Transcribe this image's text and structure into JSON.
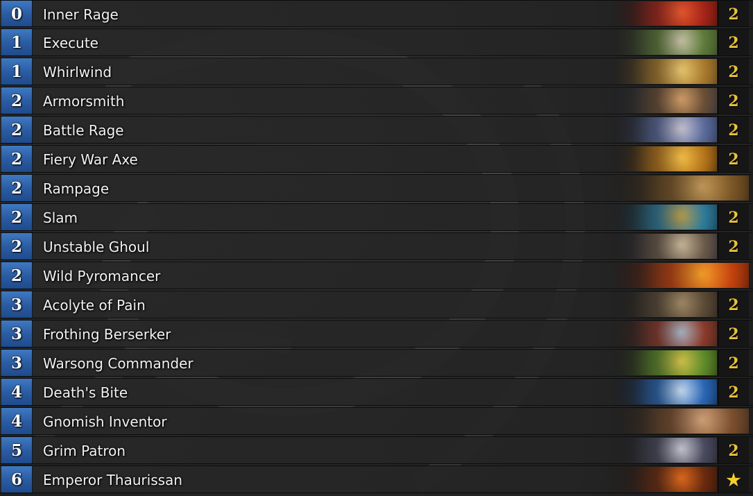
{
  "deck": {
    "cards": [
      {
        "cost": "0",
        "name": "Inner Rage",
        "count": "2",
        "art": [
          "#3a0c08",
          "#a32418",
          "#e4582e"
        ]
      },
      {
        "cost": "1",
        "name": "Execute",
        "count": "2",
        "art": [
          "#2e3a22",
          "#5d7a3a",
          "#c8c2a8"
        ]
      },
      {
        "cost": "1",
        "name": "Whirlwind",
        "count": "2",
        "art": [
          "#4a3418",
          "#a87a2e",
          "#e9c870"
        ]
      },
      {
        "cost": "2",
        "name": "Armorsmith",
        "count": "2",
        "art": [
          "#1e2a3a",
          "#6a4e36",
          "#d4a068"
        ]
      },
      {
        "cost": "2",
        "name": "Battle Rage",
        "count": "2",
        "art": [
          "#1e2840",
          "#5a6a9a",
          "#c7c4d2"
        ]
      },
      {
        "cost": "2",
        "name": "Fiery War Axe",
        "count": "2",
        "art": [
          "#2a1806",
          "#b4741a",
          "#f4c04a"
        ]
      },
      {
        "cost": "2",
        "name": "Rampage",
        "count": "",
        "art": [
          "#2a1c0e",
          "#7a5626",
          "#c49a5a"
        ]
      },
      {
        "cost": "2",
        "name": "Slam",
        "count": "2",
        "art": [
          "#0e2a3a",
          "#2e7a9a",
          "#b89a4a"
        ]
      },
      {
        "cost": "2",
        "name": "Unstable Ghoul",
        "count": "2",
        "art": [
          "#1a1e2a",
          "#6a5a4a",
          "#c8b89a"
        ]
      },
      {
        "cost": "2",
        "name": "Wild Pyromancer",
        "count": "",
        "art": [
          "#3a0e04",
          "#c2420e",
          "#f7a12a"
        ]
      },
      {
        "cost": "3",
        "name": "Acolyte of Pain",
        "count": "2",
        "art": [
          "#1e1a16",
          "#5a4a36",
          "#a08a66"
        ]
      },
      {
        "cost": "3",
        "name": "Frothing Berserker",
        "count": "2",
        "art": [
          "#2a1a16",
          "#8a3a2a",
          "#a8b4c4"
        ]
      },
      {
        "cost": "3",
        "name": "Warsong Commander",
        "count": "2",
        "art": [
          "#1e2a10",
          "#5e8a2a",
          "#d2c24a"
        ]
      },
      {
        "cost": "4",
        "name": "Death's Bite",
        "count": "2",
        "art": [
          "#0a1e3a",
          "#2a66b4",
          "#c8dcf0"
        ]
      },
      {
        "cost": "4",
        "name": "Gnomish Inventor",
        "count": "",
        "art": [
          "#2a1e16",
          "#7a4e2e",
          "#d4a47a"
        ]
      },
      {
        "cost": "5",
        "name": "Grim Patron",
        "count": "2",
        "art": [
          "#1a1a22",
          "#4a4a5e",
          "#c6c8d2"
        ]
      },
      {
        "cost": "6",
        "name": "Emperor Thaurissan",
        "count": "★",
        "art": [
          "#1e1008",
          "#6a2a0e",
          "#e06a1e"
        ]
      }
    ]
  },
  "colors": {
    "cost_blue": "#2a5aa0",
    "count_gold": "#e8c23a"
  }
}
